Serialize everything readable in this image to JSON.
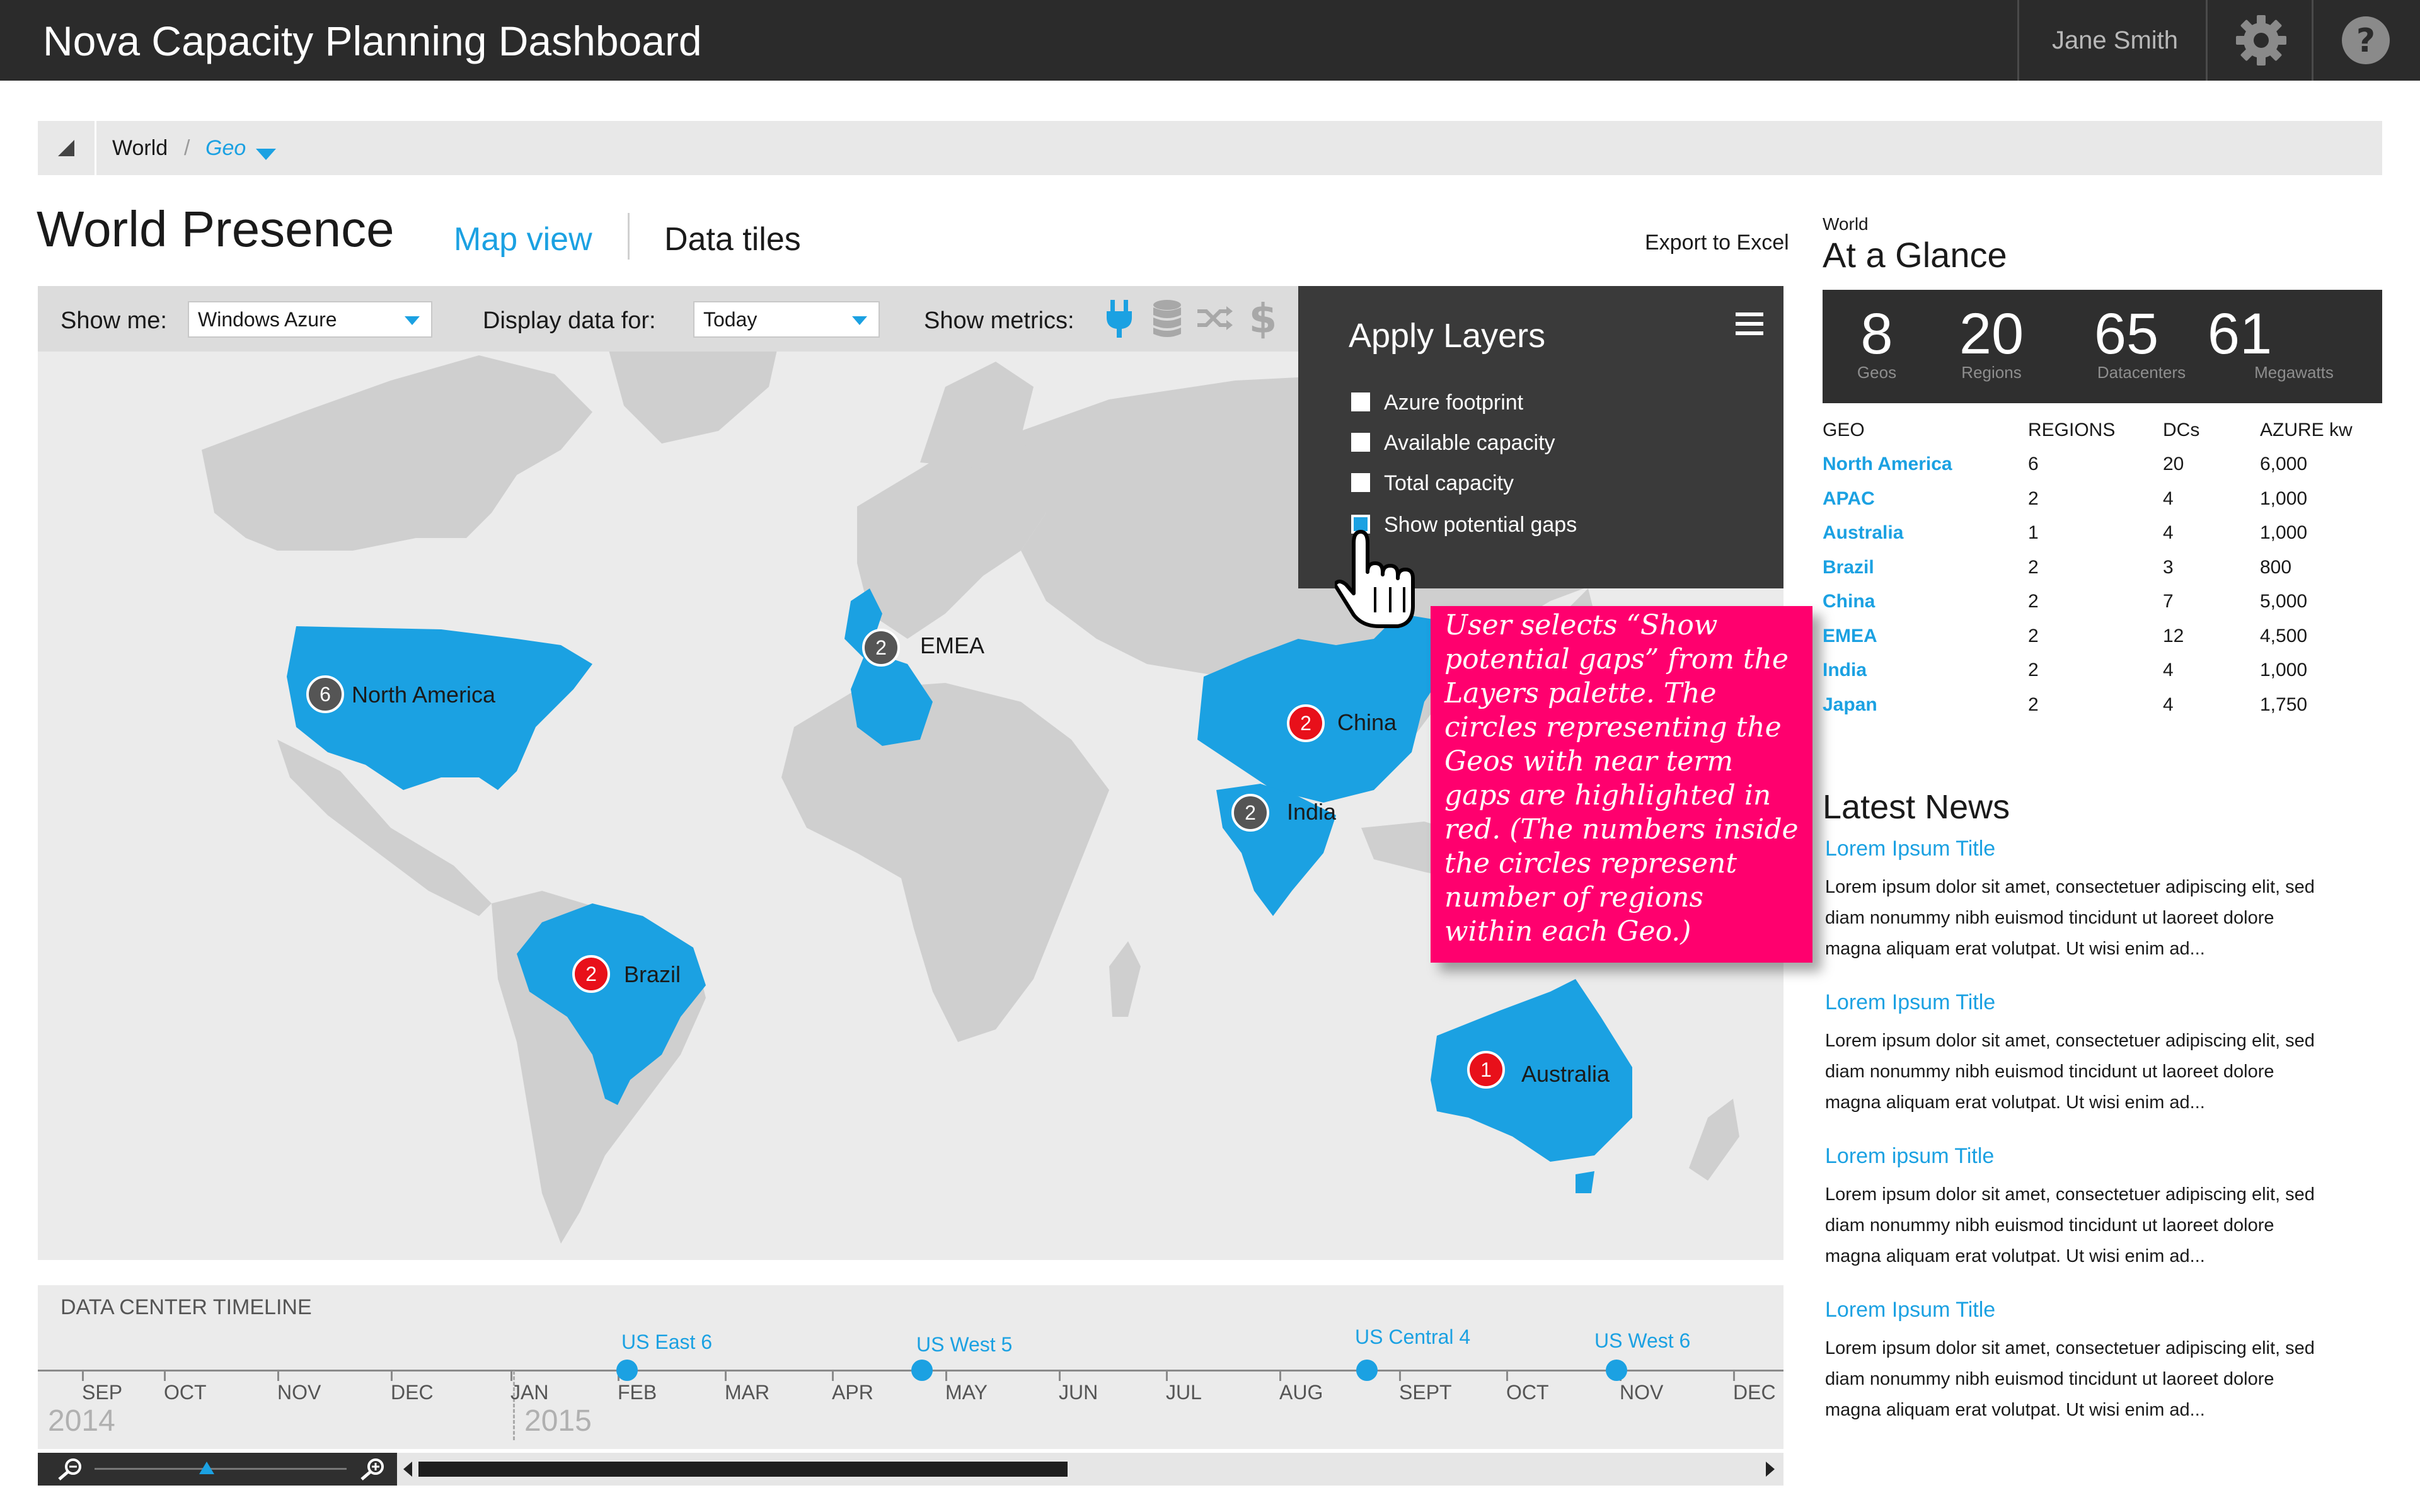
{
  "header": {
    "app_title": "Nova Capacity Planning Dashboard",
    "user_name": "Jane Smith",
    "icons": [
      "gear-icon",
      "help-icon"
    ]
  },
  "breadcrumb": {
    "world": "World",
    "separator": "/",
    "geo": "Geo"
  },
  "page": {
    "title": "World Presence",
    "tab_map": "Map view",
    "tab_tiles": "Data tiles",
    "export": "Export to Excel"
  },
  "filters": {
    "show_me_label": "Show me:",
    "show_me_value": "Windows Azure",
    "display_label": "Display data for:",
    "display_value": "Today",
    "metrics_label": "Show metrics:",
    "metric_icons": [
      "plug-icon",
      "database-icon",
      "shuffle-icon",
      "dollar-icon"
    ]
  },
  "layers": {
    "title": "Apply Layers",
    "items": [
      {
        "label": "Azure footprint",
        "checked": false
      },
      {
        "label": "Available capacity",
        "checked": false
      },
      {
        "label": "Total capacity",
        "checked": false
      },
      {
        "label": "Show potential gaps",
        "checked": true
      }
    ]
  },
  "map": {
    "geos": [
      {
        "name": "North America",
        "count": "6",
        "status": "normal"
      },
      {
        "name": "EMEA",
        "count": "2",
        "status": "normal"
      },
      {
        "name": "China",
        "count": "2",
        "status": "gap"
      },
      {
        "name": "India",
        "count": "2",
        "status": "normal"
      },
      {
        "name": "Brazil",
        "count": "2",
        "status": "gap"
      },
      {
        "name": "Australia",
        "count": "1",
        "status": "gap"
      }
    ],
    "colors": {
      "highlight": "#1ba1e2",
      "land": "#cfcfcf",
      "gap": "#e8101a"
    }
  },
  "annotation": "User selects “Show potential gaps” from the Layers palette. The circles representing the Geos with near term gaps are highlighted in red. (The numbers inside the circles represent number of regions within each Geo.)",
  "timeline": {
    "title": "DATA CENTER TIMELINE",
    "months": [
      "SEP",
      "OCT",
      "NOV",
      "DEC",
      "JAN",
      "FEB",
      "MAR",
      "APR",
      "MAY",
      "JUN",
      "JUL",
      "AUG",
      "SEPT",
      "OCT",
      "NOV",
      "DEC"
    ],
    "years": [
      "2014",
      "2015"
    ],
    "events": [
      "US East 6",
      "US West 5",
      "US Central 4",
      "US West 6"
    ]
  },
  "glance": {
    "scope": "World",
    "title": "At a Glance",
    "stats": [
      {
        "value": "8",
        "label": "Geos"
      },
      {
        "value": "20",
        "label": "Regions"
      },
      {
        "value": "65",
        "label": "Datacenters"
      },
      {
        "value": "61",
        "label": "Megawatts"
      }
    ],
    "columns": [
      "GEO",
      "REGIONS",
      "DCs",
      "AZURE kw"
    ],
    "rows": [
      [
        "North America",
        "6",
        "20",
        "6,000"
      ],
      [
        "APAC",
        "2",
        "4",
        "1,000"
      ],
      [
        "Australia",
        "1",
        "4",
        "1,000"
      ],
      [
        "Brazil",
        "2",
        "3",
        "800"
      ],
      [
        "China",
        "2",
        "7",
        "5,000"
      ],
      [
        "EMEA",
        "2",
        "12",
        "4,500"
      ],
      [
        "India",
        "2",
        "4",
        "1,000"
      ],
      [
        "Japan",
        "2",
        "4",
        "1,750"
      ]
    ]
  },
  "news": {
    "heading": "Latest News",
    "items": [
      {
        "title": "Lorem Ipsum Title",
        "l1": "Lorem ipsum dolor sit amet, consectetuer adipiscing elit, sed",
        "l2": "diam nonummy nibh euismod tincidunt ut laoreet dolore",
        "l3": "magna aliquam erat volutpat. Ut wisi enim ad..."
      },
      {
        "title": "Lorem Ipsum Title",
        "l1": "Lorem ipsum dolor sit amet, consectetuer adipiscing elit, sed",
        "l2": "diam nonummy nibh euismod tincidunt ut laoreet dolore",
        "l3": "magna aliquam erat volutpat. Ut wisi enim ad..."
      },
      {
        "title": "Lorem ipsum Title",
        "l1": "Lorem ipsum dolor sit amet, consectetuer adipiscing elit, sed",
        "l2": "diam nonummy nibh euismod tincidunt ut laoreet dolore",
        "l3": "magna aliquam erat volutpat. Ut wisi enim ad..."
      },
      {
        "title": "Lorem Ipsum Title",
        "l1": "Lorem ipsum dolor sit amet, consectetuer adipiscing elit, sed",
        "l2": "diam nonummy nibh euismod tincidunt ut laoreet dolore",
        "l3": "magna aliquam erat volutpat. Ut wisi enim ad..."
      }
    ]
  }
}
